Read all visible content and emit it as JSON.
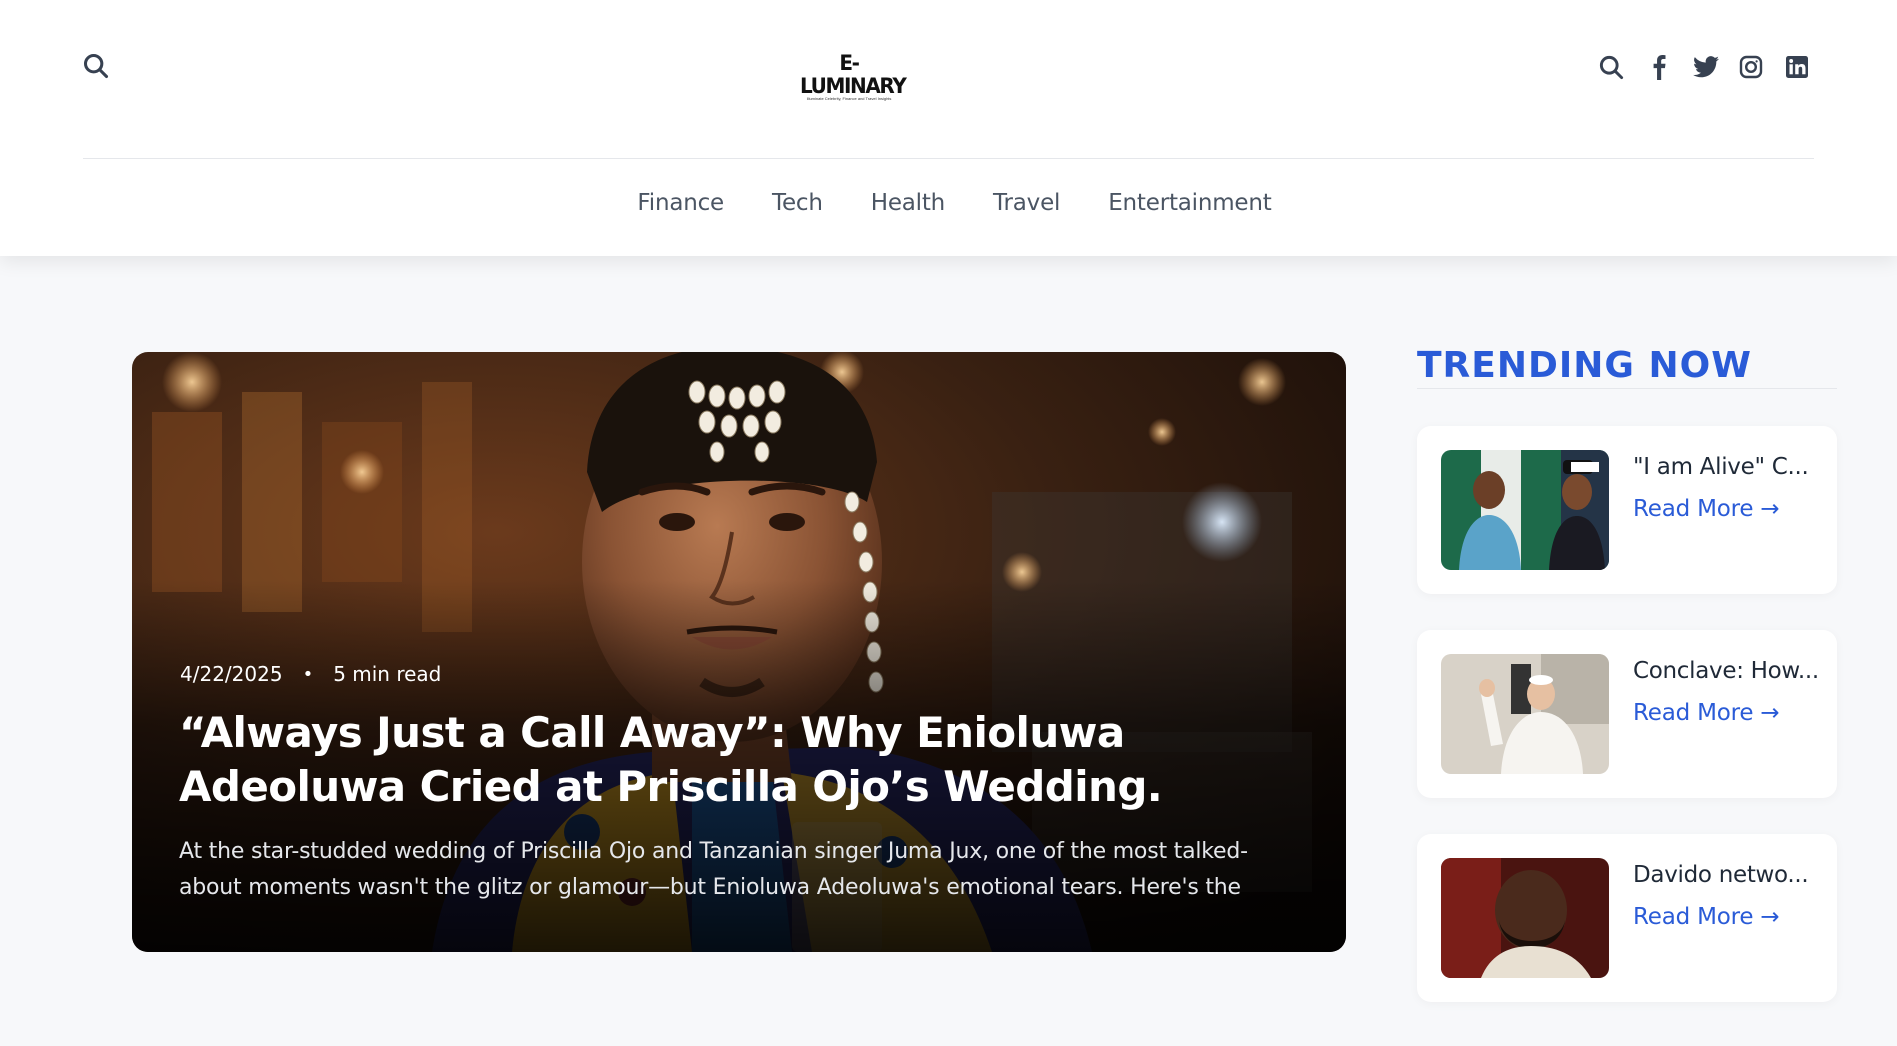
{
  "header": {
    "logo_text": "E-LUMINARY",
    "logo_tagline": "Illuminate Celebrity, Finance and Travel Insights",
    "icons": [
      "search-icon",
      "facebook-icon",
      "twitter-icon",
      "instagram-icon",
      "linkedin-icon"
    ]
  },
  "nav": {
    "items": [
      {
        "label": "Finance"
      },
      {
        "label": "Tech"
      },
      {
        "label": "Health"
      },
      {
        "label": "Travel"
      },
      {
        "label": "Entertainment"
      }
    ]
  },
  "hero": {
    "date": "4/22/2025",
    "separator": "•",
    "read_time": "5 min read",
    "title": "“Always Just a Call Away”: Why Enioluwa Adeoluwa Cried at Priscilla Ojo’s Wedding.",
    "excerpt": "At the star-studded wedding of Priscilla Ojo and Tanzanian singer Juma Jux, one of the most talked-about moments wasn't the glitz or glamour—but Enioluwa Adeoluwa's emotional tears. Here's the touching..."
  },
  "trending": {
    "heading": "TRENDING NOW",
    "items": [
      {
        "title": "\"I am Alive\" C...",
        "read_more": "Read More →"
      },
      {
        "title": "Conclave: How...",
        "read_more": "Read More →"
      },
      {
        "title": "Davido netwo...",
        "read_more": "Read More →"
      }
    ]
  },
  "colors": {
    "accent": "#2a5bd7",
    "background": "#f7f8fa",
    "nav_text": "#4b5563",
    "icon": "#374151"
  }
}
